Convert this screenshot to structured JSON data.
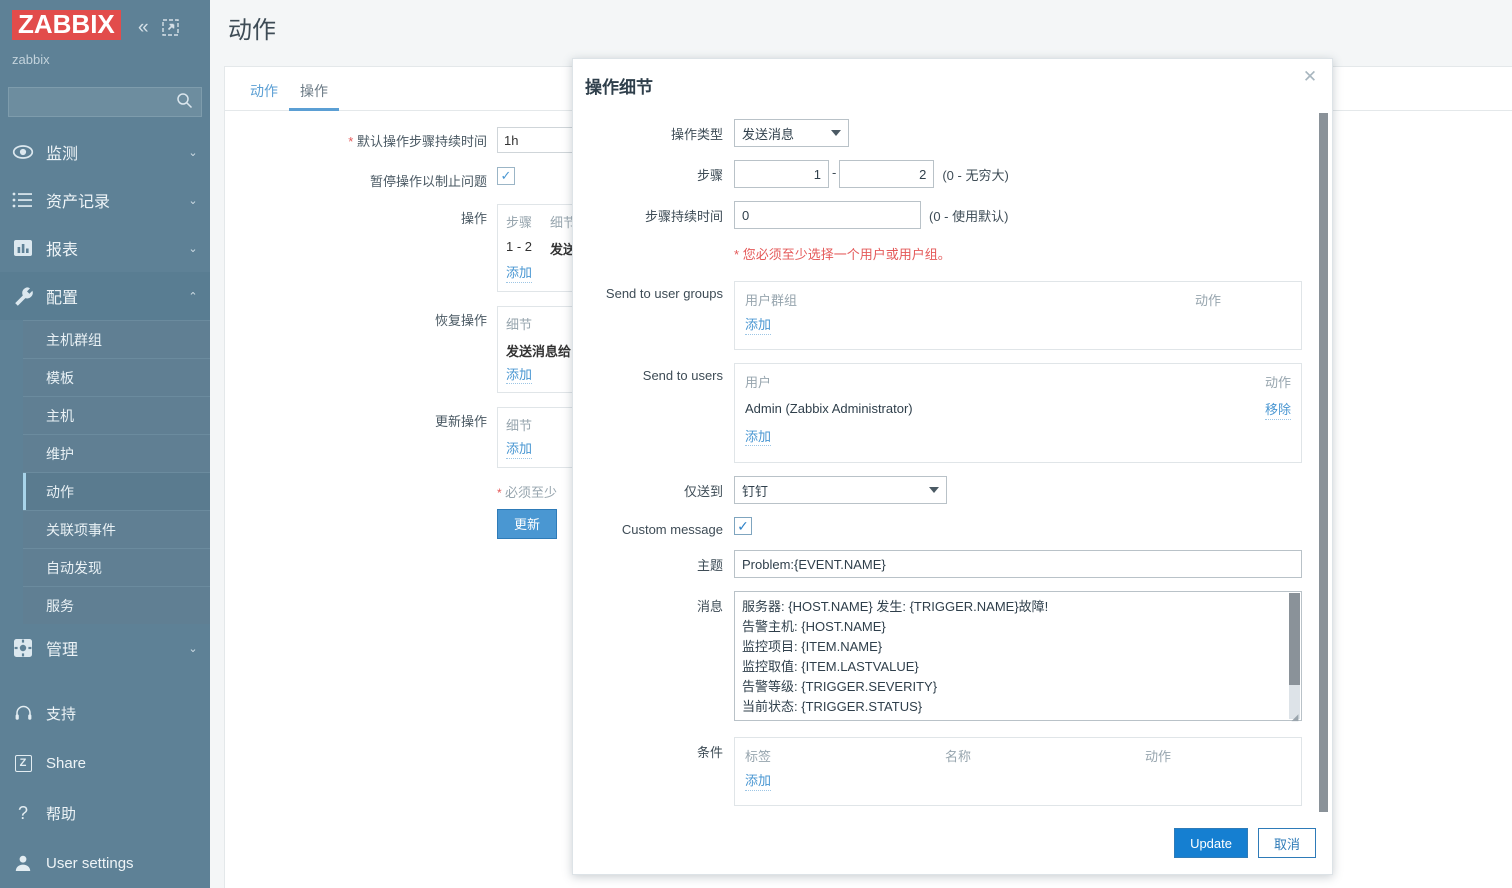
{
  "sidebar": {
    "logo_text": "ZABBIX",
    "brand": "zabbix",
    "collapse_icon": "chevron-double-left-icon",
    "kiosk_icon": "kiosk-expand-icon",
    "search": {
      "value": "",
      "placeholder": ""
    },
    "menu": [
      {
        "label": "监测",
        "icon": "eye-icon",
        "chevron": "⌄"
      },
      {
        "label": "资产记录",
        "icon": "list-icon",
        "chevron": "⌄"
      },
      {
        "label": "报表",
        "icon": "bar-chart-icon",
        "chevron": "⌄"
      },
      {
        "label": "配置",
        "icon": "wrench-icon",
        "chevron": "⌃"
      }
    ],
    "submenu": [
      {
        "label": "主机群组"
      },
      {
        "label": "模板"
      },
      {
        "label": "主机"
      },
      {
        "label": "维护"
      },
      {
        "label": "动作"
      },
      {
        "label": "关联项事件"
      },
      {
        "label": "自动发现"
      },
      {
        "label": "服务"
      }
    ],
    "admin": {
      "label": "管理",
      "icon": "gear-icon",
      "chevron": "⌄"
    },
    "bottom": [
      {
        "label": "支持",
        "icon": "headset-icon"
      },
      {
        "label": "Share",
        "icon": "zabbix-share-icon"
      },
      {
        "label": "帮助",
        "icon": "question-icon"
      },
      {
        "label": "User settings",
        "icon": "user-icon"
      }
    ]
  },
  "header": {
    "title": "动作"
  },
  "tabs": [
    {
      "label": "动作",
      "active": false
    },
    {
      "label": "操作",
      "active": true
    }
  ],
  "form": {
    "default_step_duration": {
      "label": "默认操作步骤持续时间",
      "value": "1h",
      "required": true
    },
    "pause_suppressed": {
      "label": "暂停操作以制止问题",
      "checked": true
    },
    "operations": {
      "label": "操作",
      "headers": [
        "步骤",
        "细节"
      ],
      "rows": [
        {
          "step": "1 - 2",
          "detail": "发送"
        }
      ],
      "add_label": "添加"
    },
    "recovery_operations": {
      "label": "恢复操作",
      "headers": [
        "细节"
      ],
      "rows": [
        {
          "detail": "发送消息给"
        }
      ],
      "add_label": "添加"
    },
    "update_operations": {
      "label": "更新操作",
      "headers": [
        "细节"
      ],
      "rows": [],
      "add_label": "添加"
    },
    "footnote": "必须至少",
    "update_button": "更新"
  },
  "modal": {
    "title": "操作细节",
    "close_icon": "close-icon",
    "operation_type": {
      "label": "操作类型",
      "value": "发送消息"
    },
    "steps": {
      "label": "步骤",
      "from": "1",
      "to": "2",
      "separator": "-",
      "hint": "(0 - 无穷大)"
    },
    "step_duration": {
      "label": "步骤持续时间",
      "value": "0",
      "hint": "(0 - 使用默认)"
    },
    "required_note": {
      "star": "*",
      "text": "您必须至少选择一个用户或用户组。"
    },
    "send_to_user_groups": {
      "label": "Send to user groups",
      "col_name": "用户群组",
      "col_action": "动作",
      "rows": [],
      "add_label": "添加"
    },
    "send_to_users": {
      "label": "Send to users",
      "col_name": "用户",
      "col_action": "动作",
      "rows": [
        {
          "name": "Admin (Zabbix Administrator)",
          "action": "移除"
        }
      ],
      "add_label": "添加"
    },
    "send_only_to": {
      "label": "仅送到",
      "value": "钉钉"
    },
    "custom_message": {
      "label": "Custom message",
      "checked": true
    },
    "subject": {
      "label": "主题",
      "value": "Problem:{EVENT.NAME}"
    },
    "message": {
      "label": "消息",
      "value": "服务器: {HOST.NAME} 发生: {TRIGGER.NAME}故障!\n告警主机: {HOST.NAME}\n监控项目: {ITEM.NAME}\n监控取值: {ITEM.LASTVALUE}\n告警等级: {TRIGGER.SEVERITY}\n当前状态: {TRIGGER.STATUS}"
    },
    "conditions": {
      "label": "条件",
      "col_label": "标签",
      "col_name": "名称",
      "col_action": "动作",
      "rows": [],
      "add_label": "添加"
    },
    "buttons": {
      "update": "Update",
      "cancel": "取消"
    }
  },
  "colors": {
    "sidebar_bg": "#5e8196",
    "logo_red": "#e24c4b",
    "accent_blue": "#4a97d2",
    "button_blue": "#157fd1",
    "required_red": "#e45959"
  }
}
